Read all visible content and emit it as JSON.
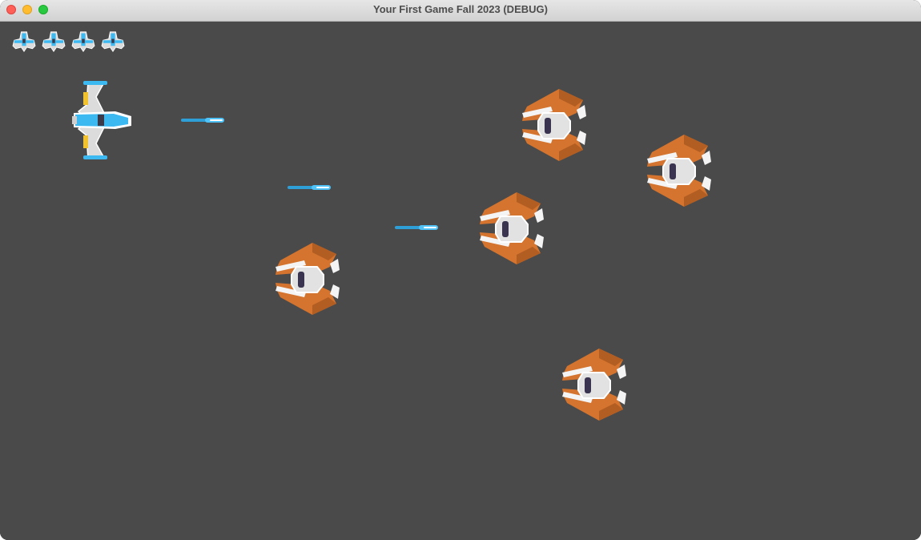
{
  "window": {
    "title": "Your First Game Fall 2023 (DEBUG)"
  },
  "hud": {
    "lives_remaining": 4,
    "life_icon": "player-ship-icon"
  },
  "colors": {
    "background": "#4a4a4a",
    "player_accent": "#3db9f2",
    "enemy_body": "#d4742e",
    "laser": "#4fc3f7"
  },
  "game": {
    "player": {
      "icon": "player-ship-icon"
    },
    "enemy_count": 5,
    "laser_count": 3
  }
}
